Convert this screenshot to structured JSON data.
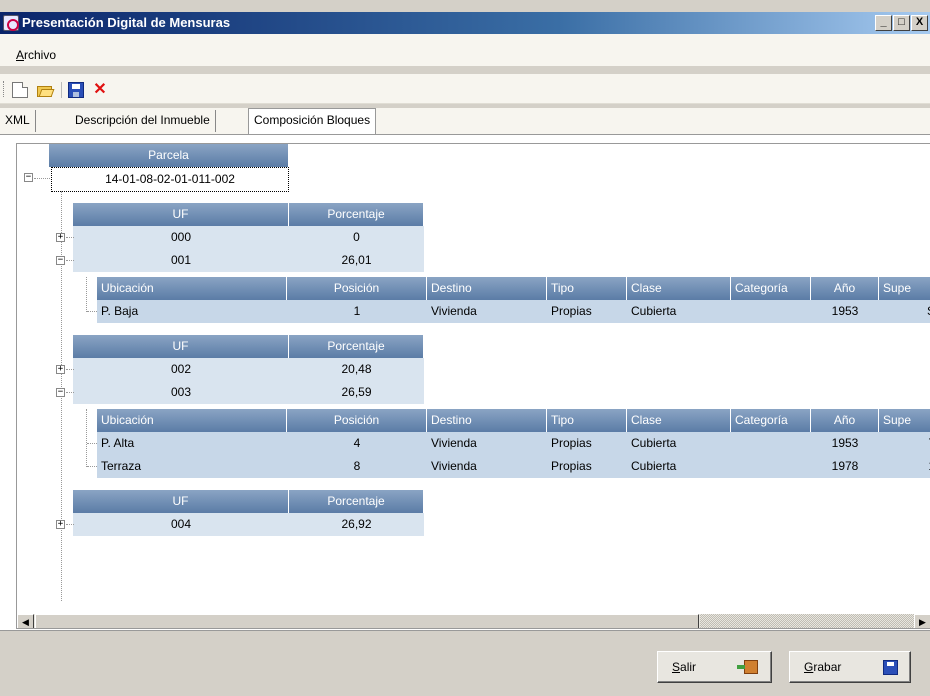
{
  "window": {
    "title": "Presentación Digital de Mensuras",
    "controls": [
      "_",
      "□",
      "X"
    ]
  },
  "menu": {
    "archivo": "Archivo"
  },
  "toolbar": {
    "icons": [
      "new-document-icon",
      "open-folder-icon",
      "save-icon",
      "delete-icon"
    ]
  },
  "tabs": [
    "XML",
    "Descripción del Inmueble",
    "Composición Bloques"
  ],
  "active_tab": "Composición Bloques",
  "grid": {
    "parcela_header": "Parcela",
    "parcela_value": "14-01-08-02-01-011-002",
    "uf_header": "UF",
    "porcentaje_header": "Porcentaje",
    "detail_headers": [
      "Ubicación",
      "Posición",
      "Destino",
      "Tipo",
      "Clase",
      "Categoría",
      "Año",
      "Supe"
    ],
    "groups": [
      {
        "uf_rows": [
          {
            "uf": "000",
            "pct": "0"
          },
          {
            "uf": "001",
            "pct": "26,01"
          }
        ],
        "details": [
          {
            "ubicacion": "P. Baja",
            "posicion": "1",
            "destino": "Vivienda",
            "tipo": "Propias",
            "clase": "Cubierta",
            "categoria": "",
            "anio": "1953",
            "sup": "S"
          }
        ]
      },
      {
        "uf_rows": [
          {
            "uf": "002",
            "pct": "20,48"
          },
          {
            "uf": "003",
            "pct": "26,59"
          }
        ],
        "details": [
          {
            "ubicacion": "P. Alta",
            "posicion": "4",
            "destino": "Vivienda",
            "tipo": "Propias",
            "clase": "Cubierta",
            "categoria": "",
            "anio": "1953",
            "sup": "7"
          },
          {
            "ubicacion": "Terraza",
            "posicion": "8",
            "destino": "Vivienda",
            "tipo": "Propias",
            "clase": "Cubierta",
            "categoria": "",
            "anio": "1978",
            "sup": "1"
          }
        ]
      },
      {
        "uf_rows": [
          {
            "uf": "004",
            "pct": "26,92"
          }
        ],
        "details": []
      }
    ]
  },
  "buttons": {
    "salir": "Salir",
    "grabar": "Grabar"
  }
}
